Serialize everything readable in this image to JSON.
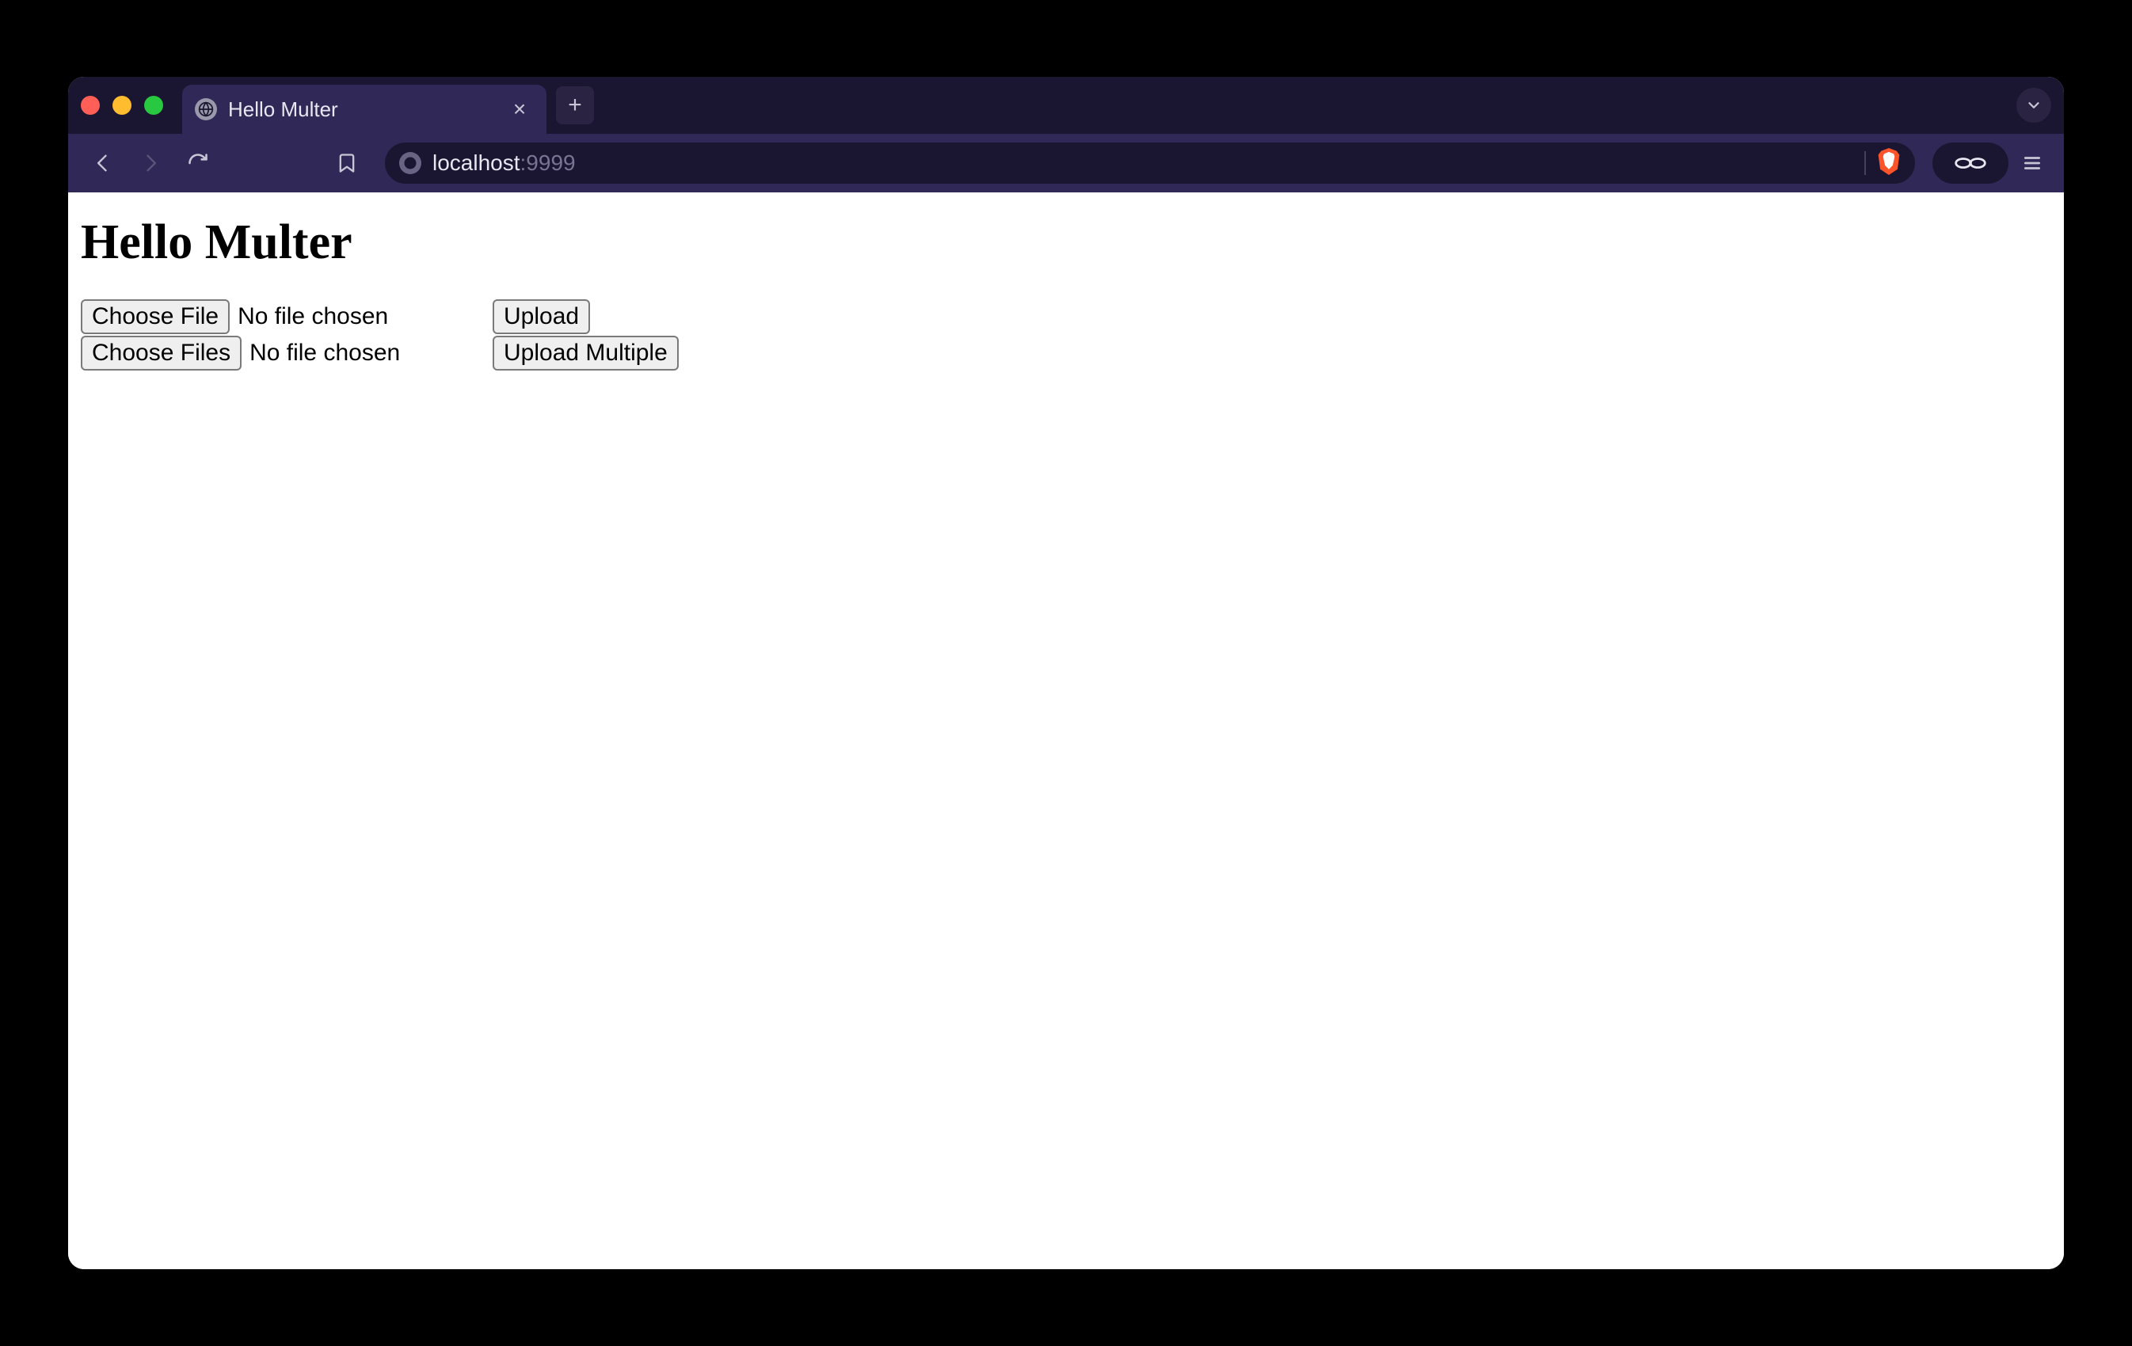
{
  "browser": {
    "tab": {
      "title": "Hello Multer"
    },
    "url": {
      "host": "localhost",
      "port": ":9999"
    }
  },
  "page": {
    "heading": "Hello Multer",
    "forms": [
      {
        "choose_label": "Choose File",
        "status": "No file chosen",
        "submit_label": "Upload"
      },
      {
        "choose_label": "Choose Files",
        "status": "No file chosen",
        "submit_label": "Upload Multiple"
      }
    ]
  }
}
